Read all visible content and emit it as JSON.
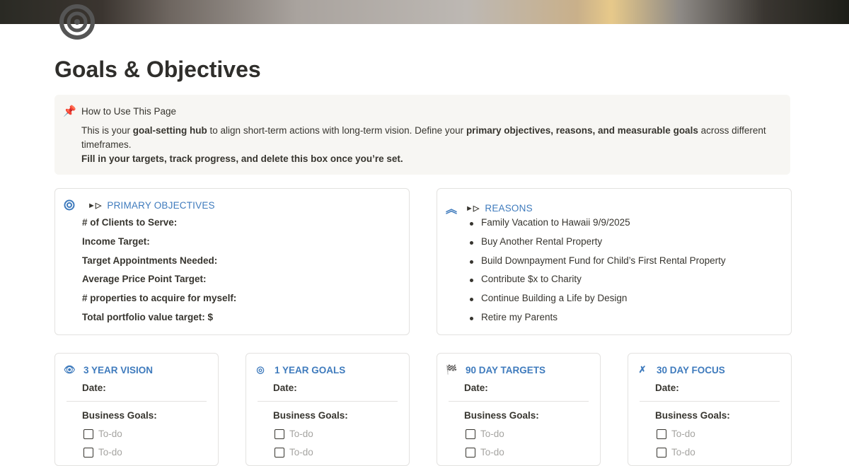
{
  "page": {
    "title": "Goals & Objectives",
    "icon": "target-icon"
  },
  "callout": {
    "icon": "pushpin-icon",
    "title": "How to Use This Page",
    "line1_a": "This is your ",
    "line1_b": "goal-setting hub",
    "line1_c": " to align short-term actions with long-term vision.  Define your ",
    "line1_d": "primary objectives, reasons, and measurable goals",
    "line1_e": " across different timeframes.",
    "line2": "Fill in your targets, track progress, and delete this box once you’re set."
  },
  "primary": {
    "arrows": "►▷",
    "title": "PRIMARY OBJECTIVES",
    "items": [
      "# of Clients to Serve:",
      " Income Target:",
      "Target Appointments Needed:",
      "Average Price Point Target:",
      "# properties to acquire for myself:",
      "Total portfolio value target: $"
    ]
  },
  "reasons": {
    "arrows": "►▷",
    "title": "REASONS",
    "items": [
      "Family Vacation to Hawaii 9/9/2025",
      "Buy Another Rental Property",
      "Build Downpayment Fund for Child’s First Rental Property",
      "Contribute $x to Charity",
      "Continue Building a Life by Design",
      "Retire my Parents"
    ]
  },
  "timeframes": [
    {
      "title": "3 YEAR VISION",
      "icon": "eye-icon",
      "date": "Date:",
      "section": "Business Goals:",
      "todos": [
        "To-do",
        "To-do"
      ]
    },
    {
      "title": "1 YEAR GOALS",
      "icon": "target-icon",
      "date": "Date:",
      "section": "Business Goals:",
      "todos": [
        "To-do",
        "To-do"
      ]
    },
    {
      "title": "90 DAY TARGETS",
      "icon": "checkered-flag-icon",
      "date": "Date:",
      "section": "Business Goals:",
      "todos": [
        "To-do",
        "To-do"
      ]
    },
    {
      "title": "30 DAY FOCUS",
      "icon": "crossed-arrows-icon",
      "date": "Date:",
      "section": "Business Goals:",
      "todos": [
        "To-do",
        "To-do"
      ]
    }
  ],
  "colors": {
    "accent": "#3f7bbd",
    "callout_bg": "#f7f6f3"
  }
}
